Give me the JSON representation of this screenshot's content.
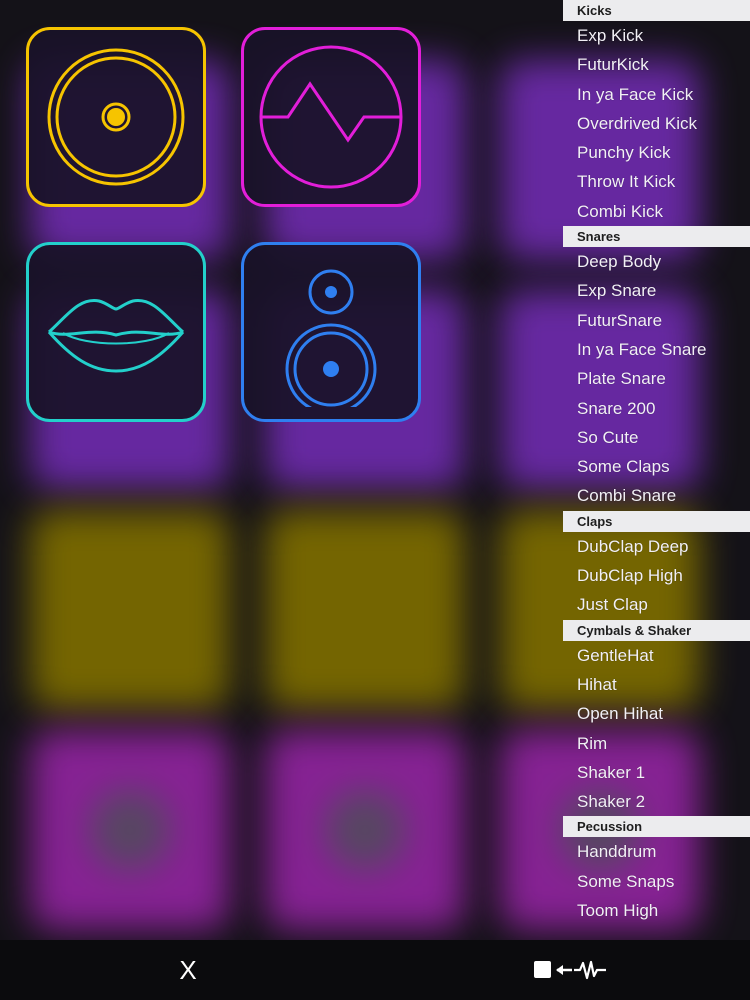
{
  "toolbar": {
    "close_label": "X"
  },
  "colors": {
    "kick_tile": "#f6c400",
    "wave_tile": "#e21ed9",
    "lips_tile": "#23d0cb",
    "speaker_tile": "#2f7ff0",
    "list_header_bg": "#ececee",
    "list_text": "#f2f0f6"
  },
  "tiles": [
    {
      "icon": "kick-drum-icon"
    },
    {
      "icon": "waveform-icon"
    },
    {
      "icon": "lips-icon"
    },
    {
      "icon": "speaker-icon"
    }
  ],
  "sound_list": {
    "sections": [
      {
        "title": "Kicks",
        "items": [
          "Exp Kick",
          "FuturKick",
          "In ya Face Kick",
          "Overdrived Kick",
          "Punchy Kick",
          "Throw It Kick",
          "Combi Kick"
        ]
      },
      {
        "title": "Snares",
        "items": [
          "Deep Body",
          "Exp Snare",
          "FuturSnare",
          "In ya Face Snare",
          "Plate Snare",
          "Snare 200",
          "So Cute",
          "Some Claps",
          "Combi Snare"
        ]
      },
      {
        "title": "Claps",
        "items": [
          "DubClap Deep",
          "DubClap High",
          "Just Clap"
        ]
      },
      {
        "title": "Cymbals & Shaker",
        "items": [
          "GentleHat",
          "Hihat",
          "Open Hihat",
          "Rim",
          "Shaker 1",
          "Shaker 2"
        ]
      },
      {
        "title": "Pecussion",
        "items": [
          "Handdrum",
          "Some Snaps",
          "Toom High"
        ]
      }
    ]
  }
}
